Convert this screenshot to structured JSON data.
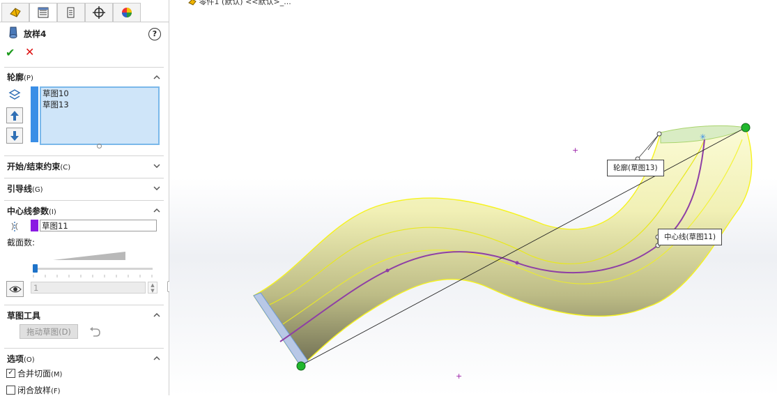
{
  "breadcrumb": "零件1 (默认) <<默认>_...",
  "feature": {
    "title": "放样4",
    "help": "?"
  },
  "actions": {
    "ok": "✔",
    "cancel": "✕"
  },
  "tabs": [
    "feature-manager-icon",
    "property-manager-icon",
    "configuration-manager-icon",
    "dimxpert-icon",
    "display-manager-icon"
  ],
  "profiles": {
    "header": "轮廓",
    "shortcut": "(P)",
    "items": [
      "草图10",
      "草图13"
    ]
  },
  "start_end": {
    "header": "开始/结束约束",
    "shortcut": "(C)"
  },
  "guides": {
    "header": "引导线",
    "shortcut": "(G)"
  },
  "centerline": {
    "header": "中心线参数",
    "shortcut": "(I)",
    "value": "草图11",
    "sections_label": "截面数:",
    "sections_value": "1"
  },
  "sketch_tools": {
    "header": "草图工具",
    "drag_button": "拖动草图(D)"
  },
  "options": {
    "header": "选项",
    "shortcut": "(O)",
    "merge_tangent": {
      "label": "合并切面",
      "shortcut": "(M)",
      "checked": true
    },
    "close_loft": {
      "label": "闭合放样",
      "shortcut": "(F)",
      "checked": false
    }
  },
  "callouts": {
    "profile": "轮廓(草图13)",
    "centerline": "中心线(草图11)"
  },
  "colors": {
    "accent_blue": "#3a8ee6",
    "centerline_purple": "#8a1be2",
    "loft_yellow": "#f1f0a8"
  }
}
